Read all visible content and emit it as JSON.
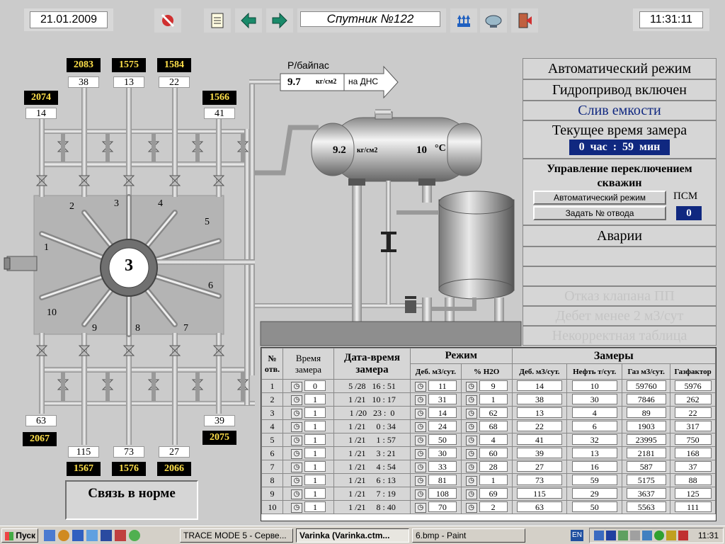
{
  "header": {
    "date": "21.01.2009",
    "title": "Спутник №122",
    "time": "11:31:11"
  },
  "wells_top": [
    {
      "id": "2083",
      "num": "38"
    },
    {
      "id": "1575",
      "num": "13"
    },
    {
      "id": "1584",
      "num": "22"
    },
    {
      "id": "2074",
      "num": "14"
    },
    {
      "id": "1566",
      "num": "41"
    }
  ],
  "wells_bottom": [
    {
      "id": "2067",
      "num": "63"
    },
    {
      "id": "2075",
      "num": "39"
    },
    {
      "id": "1567",
      "num": "115"
    },
    {
      "id": "1576",
      "num": "73"
    },
    {
      "id": "2066",
      "num": "27"
    }
  ],
  "branch_numbers": [
    "1",
    "2",
    "3",
    "4",
    "5",
    "6",
    "7",
    "8",
    "9",
    "10"
  ],
  "manifold_label": "3",
  "bypass": {
    "label": "Р/байпас",
    "value": "9.7",
    "unit": "кг/см2",
    "dest": "на ДНС"
  },
  "separator": {
    "pressure": "9.2",
    "pressure_unit": "кг/см2",
    "temp": "10",
    "temp_unit": "°С"
  },
  "status": {
    "mode": "Автоматический режим",
    "hydraulic": "Гидропривод включен",
    "drain": "Слив емкости",
    "measure_time_label": "Текущее время замера",
    "measure_time": "0  час  :  59  мин",
    "switch_title": "Управление переключением скважин",
    "auto_btn": "Автоматический режим",
    "set_btn": "Задать № отвода",
    "psm_label": "ПСМ",
    "psm_value": "0",
    "alarms_title": "Аварии",
    "alarm1": "Отказ клапана ПП",
    "alarm2": "Дебет менее 2 м3/сут",
    "alarm3": "Некорректная таблица"
  },
  "connection": "Связь в норме",
  "table": {
    "h_no": "№ отв.",
    "h_time": "Время замера",
    "h_datetime": "Дата-время замера",
    "h_mode": "Режим",
    "h_meas": "Замеры",
    "h_deb": "Деб. м3/сут.",
    "h_h2o": "% H2O",
    "h_deb2": "Деб. м3/сут.",
    "h_oil": "Нефть т/сут.",
    "h_gas": "Газ м3/сут.",
    "h_gf": "Газфактор",
    "rows": [
      {
        "n": "1",
        "t": "0",
        "dt": "5 /28   16 : 51",
        "deb": "11",
        "h2o": "9",
        "d2": "14",
        "oil": "10",
        "gas": "59760",
        "gf": "5976"
      },
      {
        "n": "2",
        "t": "1",
        "dt": "1 /21   10 : 17",
        "deb": "31",
        "h2o": "1",
        "d2": "38",
        "oil": "30",
        "gas": "7846",
        "gf": "262"
      },
      {
        "n": "3",
        "t": "1",
        "dt": "1 /20   23 :  0",
        "deb": "14",
        "h2o": "62",
        "d2": "13",
        "oil": "4",
        "gas": "89",
        "gf": "22"
      },
      {
        "n": "4",
        "t": "1",
        "dt": "1 /21     0 : 34",
        "deb": "24",
        "h2o": "68",
        "d2": "22",
        "oil": "6",
        "gas": "1903",
        "gf": "317"
      },
      {
        "n": "5",
        "t": "1",
        "dt": "1 /21     1 : 57",
        "deb": "50",
        "h2o": "4",
        "d2": "41",
        "oil": "32",
        "gas": "23995",
        "gf": "750"
      },
      {
        "n": "6",
        "t": "1",
        "dt": "1 /21     3 : 21",
        "deb": "30",
        "h2o": "60",
        "d2": "39",
        "oil": "13",
        "gas": "2181",
        "gf": "168"
      },
      {
        "n": "7",
        "t": "1",
        "dt": "1 /21     4 : 54",
        "deb": "33",
        "h2o": "28",
        "d2": "27",
        "oil": "16",
        "gas": "587",
        "gf": "37"
      },
      {
        "n": "8",
        "t": "1",
        "dt": "1 /21     6 : 13",
        "deb": "81",
        "h2o": "1",
        "d2": "73",
        "oil": "59",
        "gas": "5175",
        "gf": "88"
      },
      {
        "n": "9",
        "t": "1",
        "dt": "1 /21     7 : 19",
        "deb": "108",
        "h2o": "69",
        "d2": "115",
        "oil": "29",
        "gas": "3637",
        "gf": "125"
      },
      {
        "n": "10",
        "t": "1",
        "dt": "1 /21     8 : 40",
        "deb": "70",
        "h2o": "2",
        "d2": "63",
        "oil": "50",
        "gas": "5563",
        "gf": "111"
      }
    ]
  },
  "taskbar": {
    "start": "Пуск",
    "task1": "TRACE MODE 5 - Серве...",
    "task2": "Varinka (Varinka.ctm...",
    "task3": "6.bmp - Paint",
    "lang": "EN",
    "clock": "11:31"
  }
}
